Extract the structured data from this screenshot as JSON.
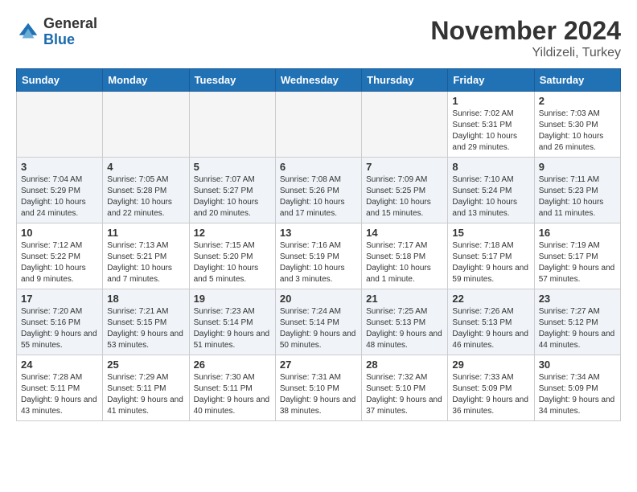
{
  "header": {
    "logo_general": "General",
    "logo_blue": "Blue",
    "month_title": "November 2024",
    "location": "Yildizeli, Turkey"
  },
  "days_of_week": [
    "Sunday",
    "Monday",
    "Tuesday",
    "Wednesday",
    "Thursday",
    "Friday",
    "Saturday"
  ],
  "weeks": [
    [
      {
        "day": "",
        "info": ""
      },
      {
        "day": "",
        "info": ""
      },
      {
        "day": "",
        "info": ""
      },
      {
        "day": "",
        "info": ""
      },
      {
        "day": "",
        "info": ""
      },
      {
        "day": "1",
        "info": "Sunrise: 7:02 AM\nSunset: 5:31 PM\nDaylight: 10 hours and 29 minutes."
      },
      {
        "day": "2",
        "info": "Sunrise: 7:03 AM\nSunset: 5:30 PM\nDaylight: 10 hours and 26 minutes."
      }
    ],
    [
      {
        "day": "3",
        "info": "Sunrise: 7:04 AM\nSunset: 5:29 PM\nDaylight: 10 hours and 24 minutes."
      },
      {
        "day": "4",
        "info": "Sunrise: 7:05 AM\nSunset: 5:28 PM\nDaylight: 10 hours and 22 minutes."
      },
      {
        "day": "5",
        "info": "Sunrise: 7:07 AM\nSunset: 5:27 PM\nDaylight: 10 hours and 20 minutes."
      },
      {
        "day": "6",
        "info": "Sunrise: 7:08 AM\nSunset: 5:26 PM\nDaylight: 10 hours and 17 minutes."
      },
      {
        "day": "7",
        "info": "Sunrise: 7:09 AM\nSunset: 5:25 PM\nDaylight: 10 hours and 15 minutes."
      },
      {
        "day": "8",
        "info": "Sunrise: 7:10 AM\nSunset: 5:24 PM\nDaylight: 10 hours and 13 minutes."
      },
      {
        "day": "9",
        "info": "Sunrise: 7:11 AM\nSunset: 5:23 PM\nDaylight: 10 hours and 11 minutes."
      }
    ],
    [
      {
        "day": "10",
        "info": "Sunrise: 7:12 AM\nSunset: 5:22 PM\nDaylight: 10 hours and 9 minutes."
      },
      {
        "day": "11",
        "info": "Sunrise: 7:13 AM\nSunset: 5:21 PM\nDaylight: 10 hours and 7 minutes."
      },
      {
        "day": "12",
        "info": "Sunrise: 7:15 AM\nSunset: 5:20 PM\nDaylight: 10 hours and 5 minutes."
      },
      {
        "day": "13",
        "info": "Sunrise: 7:16 AM\nSunset: 5:19 PM\nDaylight: 10 hours and 3 minutes."
      },
      {
        "day": "14",
        "info": "Sunrise: 7:17 AM\nSunset: 5:18 PM\nDaylight: 10 hours and 1 minute."
      },
      {
        "day": "15",
        "info": "Sunrise: 7:18 AM\nSunset: 5:17 PM\nDaylight: 9 hours and 59 minutes."
      },
      {
        "day": "16",
        "info": "Sunrise: 7:19 AM\nSunset: 5:17 PM\nDaylight: 9 hours and 57 minutes."
      }
    ],
    [
      {
        "day": "17",
        "info": "Sunrise: 7:20 AM\nSunset: 5:16 PM\nDaylight: 9 hours and 55 minutes."
      },
      {
        "day": "18",
        "info": "Sunrise: 7:21 AM\nSunset: 5:15 PM\nDaylight: 9 hours and 53 minutes."
      },
      {
        "day": "19",
        "info": "Sunrise: 7:23 AM\nSunset: 5:14 PM\nDaylight: 9 hours and 51 minutes."
      },
      {
        "day": "20",
        "info": "Sunrise: 7:24 AM\nSunset: 5:14 PM\nDaylight: 9 hours and 50 minutes."
      },
      {
        "day": "21",
        "info": "Sunrise: 7:25 AM\nSunset: 5:13 PM\nDaylight: 9 hours and 48 minutes."
      },
      {
        "day": "22",
        "info": "Sunrise: 7:26 AM\nSunset: 5:13 PM\nDaylight: 9 hours and 46 minutes."
      },
      {
        "day": "23",
        "info": "Sunrise: 7:27 AM\nSunset: 5:12 PM\nDaylight: 9 hours and 44 minutes."
      }
    ],
    [
      {
        "day": "24",
        "info": "Sunrise: 7:28 AM\nSunset: 5:11 PM\nDaylight: 9 hours and 43 minutes."
      },
      {
        "day": "25",
        "info": "Sunrise: 7:29 AM\nSunset: 5:11 PM\nDaylight: 9 hours and 41 minutes."
      },
      {
        "day": "26",
        "info": "Sunrise: 7:30 AM\nSunset: 5:11 PM\nDaylight: 9 hours and 40 minutes."
      },
      {
        "day": "27",
        "info": "Sunrise: 7:31 AM\nSunset: 5:10 PM\nDaylight: 9 hours and 38 minutes."
      },
      {
        "day": "28",
        "info": "Sunrise: 7:32 AM\nSunset: 5:10 PM\nDaylight: 9 hours and 37 minutes."
      },
      {
        "day": "29",
        "info": "Sunrise: 7:33 AM\nSunset: 5:09 PM\nDaylight: 9 hours and 36 minutes."
      },
      {
        "day": "30",
        "info": "Sunrise: 7:34 AM\nSunset: 5:09 PM\nDaylight: 9 hours and 34 minutes."
      }
    ]
  ]
}
